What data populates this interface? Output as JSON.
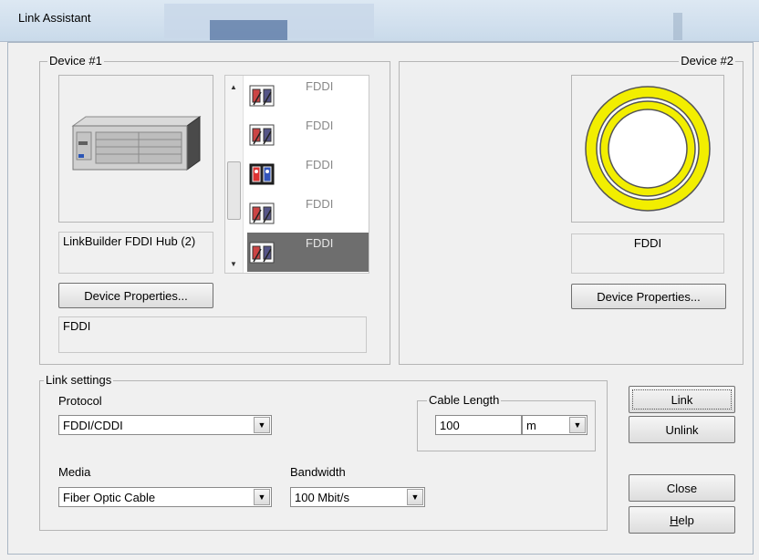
{
  "window": {
    "title": "Link Assistant"
  },
  "device1": {
    "legend": "Device #1",
    "name": "LinkBuilder FDDI Hub (2)",
    "properties_button": "Device Properties...",
    "port_description": "FDDI",
    "port_list": [
      {
        "label": "FDDI",
        "icon": "fiber-port-icon",
        "selected": false
      },
      {
        "label": "FDDI",
        "icon": "fiber-port-icon",
        "selected": false
      },
      {
        "label": "FDDI",
        "icon": "dual-port-icon",
        "selected": false
      },
      {
        "label": "FDDI",
        "icon": "fiber-port-icon",
        "selected": false
      },
      {
        "label": "FDDI",
        "icon": "fiber-port-icon",
        "selected": true
      }
    ]
  },
  "device2": {
    "legend": "Device #2",
    "name": "FDDI",
    "properties_button": "Device Properties...",
    "icon": "fddi-ring-icon"
  },
  "link_settings": {
    "legend": "Link settings",
    "protocol_label": "Protocol",
    "protocol_value": "FDDI/CDDI",
    "cable_length_legend": "Cable Length",
    "cable_length_value": "100",
    "cable_length_unit": "m",
    "media_label": "Media",
    "media_value": "Fiber Optic Cable",
    "bandwidth_label": "Bandwidth",
    "bandwidth_value": "100 Mbit/s"
  },
  "buttons": {
    "link": "Link",
    "unlink": "Unlink",
    "close": "Close",
    "help_underlined": "H",
    "help_rest": "elp"
  },
  "colors": {
    "ring": "#f2ee00",
    "selected_row": "#6e6e6e",
    "title_bar": "#d2e0ee"
  }
}
